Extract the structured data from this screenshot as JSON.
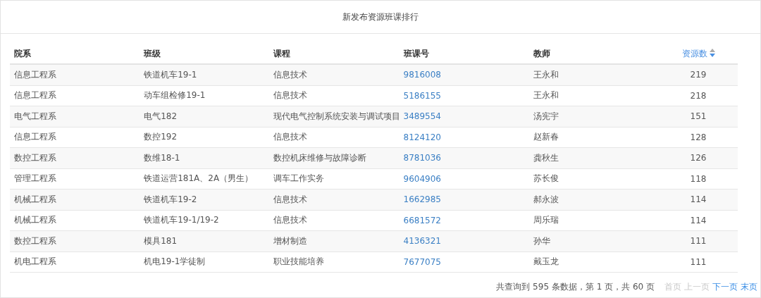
{
  "panel": {
    "title": "新发布资源班课排行"
  },
  "table": {
    "columns": [
      {
        "label": "院系"
      },
      {
        "label": "班级"
      },
      {
        "label": "课程"
      },
      {
        "label": "班课号"
      },
      {
        "label": "教师"
      },
      {
        "label": "资源数",
        "sorted": true,
        "descending": true
      }
    ],
    "rows": [
      {
        "cells": [
          "信息工程系",
          "铁道机车19-1",
          "信息技术",
          "9816008",
          "王永和",
          "219"
        ]
      },
      {
        "cells": [
          "信息工程系",
          "动车组检修19-1",
          "信息技术",
          "5186155",
          "王永和",
          "218"
        ]
      },
      {
        "cells": [
          "电气工程系",
          "电气182",
          "现代电气控制系统安装与调试项目",
          "3489554",
          "汤宪宇",
          "151"
        ]
      },
      {
        "cells": [
          "信息工程系",
          "数控192",
          "信息技术",
          "8124120",
          "赵新春",
          "128"
        ]
      },
      {
        "cells": [
          "数控工程系",
          "数维18-1",
          "数控机床维修与故障诊断",
          "8781036",
          "龚秋生",
          "126"
        ]
      },
      {
        "cells": [
          "管理工程系",
          "铁道运营181A、2A（男生）",
          "调车工作实务",
          "9604906",
          "苏长俊",
          "118"
        ]
      },
      {
        "cells": [
          "机械工程系",
          "铁道机车19-2",
          "信息技术",
          "1662985",
          "郝永波",
          "114"
        ]
      },
      {
        "cells": [
          "机械工程系",
          "铁道机车19-1/19-2",
          "信息技术",
          "6681572",
          "周乐瑞",
          "114"
        ]
      },
      {
        "cells": [
          "数控工程系",
          "模具181",
          "增材制造",
          "4136321",
          "孙华",
          "111"
        ]
      },
      {
        "cells": [
          "机电工程系",
          "机电19-1学徒制",
          "职业技能培养",
          "7677075",
          "戴玉龙",
          "111"
        ]
      }
    ]
  },
  "pager": {
    "summary": "共查询到 595 条数据，第 1 页，共 60 页",
    "links": [
      {
        "label": "首页",
        "disabled": true
      },
      {
        "label": "上一页",
        "disabled": true
      },
      {
        "label": "下一页",
        "disabled": false
      },
      {
        "label": "末页",
        "disabled": false
      }
    ]
  }
}
